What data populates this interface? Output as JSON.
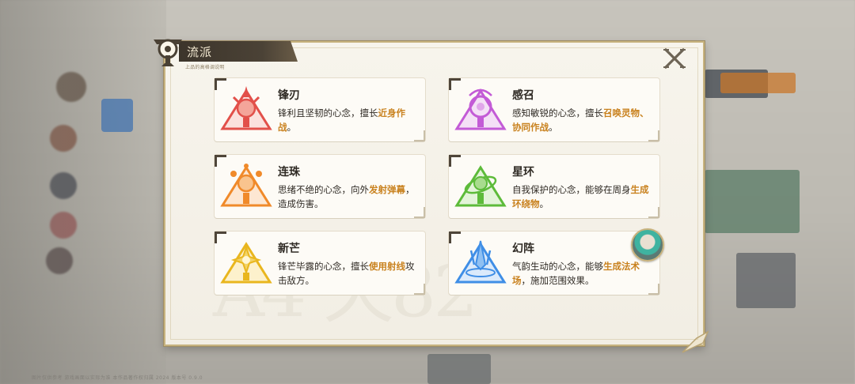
{
  "header": {
    "title": "流派",
    "subtitle": "上品的高格调说明"
  },
  "close_label": "X",
  "watermark": "A4 天82",
  "cards": [
    {
      "name": "锋刃",
      "desc_plain": "锋利且坚韧的心念，擅长",
      "desc_highlight": "近身作战",
      "desc_tail": "。",
      "icon": "blade-crest-icon",
      "color": "#e2504a"
    },
    {
      "name": "感召",
      "desc_plain": "感知敏锐的心念，擅长",
      "desc_highlight": "召唤灵物、协同作战",
      "desc_tail": "。",
      "icon": "summon-crest-icon",
      "color": "#c35bd6"
    },
    {
      "name": "连珠",
      "desc_plain": "思绪不绝的心念，向外",
      "desc_highlight": "发射弹幕",
      "desc_tail": "，造成伤害。",
      "icon": "barrage-crest-icon",
      "color": "#f08a2a"
    },
    {
      "name": "星环",
      "desc_plain": "自我保护的心念，能够在周身",
      "desc_highlight": "生成环绕物",
      "desc_tail": "。",
      "icon": "orbit-crest-icon",
      "color": "#5dbb3a"
    },
    {
      "name": "新芒",
      "desc_plain": "锋芒毕露的心念，擅长",
      "desc_highlight": "使用射线",
      "desc_tail": "攻击敌方。",
      "icon": "ray-crest-icon",
      "color": "#e9b61e"
    },
    {
      "name": "幻阵",
      "desc_plain": "气韵生动的心念，能够",
      "desc_highlight": "生成法术场",
      "desc_tail": "，施加范围效果。",
      "icon": "formation-crest-icon",
      "color": "#3f8ee6"
    }
  ],
  "footer_text": "图片仅供参考 游戏画面以实际为准 本作品著作权归属 2024 版本号 0.9.0",
  "colors": {
    "accent": "#c9821f",
    "panel_border": "#c7b37f",
    "title_bar": "#3c352b"
  }
}
